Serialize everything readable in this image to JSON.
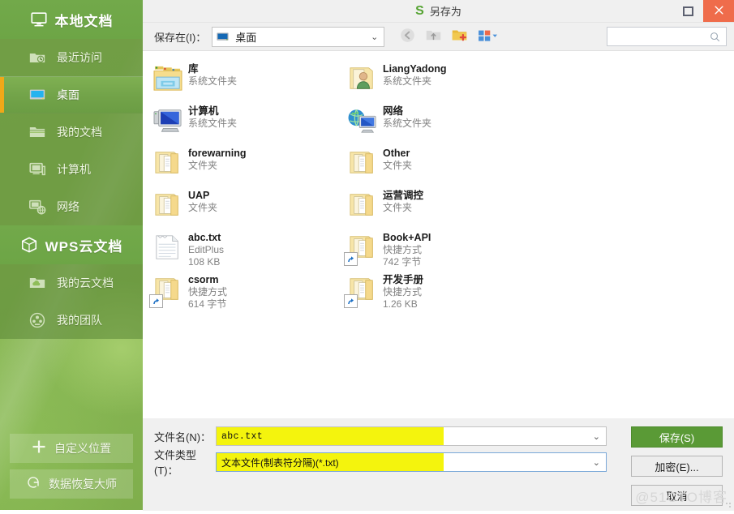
{
  "sidebar": {
    "local_header": {
      "label": "本地文档",
      "icon": "monitor-icon"
    },
    "local_items": [
      {
        "label": "最近访问",
        "icon": "recent-folder-icon",
        "selected": false
      },
      {
        "label": "桌面",
        "icon": "desktop-icon",
        "selected": true
      },
      {
        "label": "我的文档",
        "icon": "folder-icon",
        "selected": false
      },
      {
        "label": "计算机",
        "icon": "computer-icon",
        "selected": false
      },
      {
        "label": "网络",
        "icon": "network-icon",
        "selected": false
      }
    ],
    "cloud_header": {
      "label": "WPS云文档",
      "icon": "cube-icon"
    },
    "cloud_items": [
      {
        "label": "我的云文档",
        "icon": "cloud-folder-icon",
        "selected": false
      },
      {
        "label": "我的团队",
        "icon": "team-icon",
        "selected": false
      }
    ],
    "bottom_buttons": [
      {
        "label": "自定义位置",
        "icon": "plus-icon"
      },
      {
        "label": "数据恢复大师",
        "icon": "recovery-g-icon"
      }
    ]
  },
  "titlebar": {
    "logo_text": "S",
    "title": "另存为",
    "maximize_label": "maximize",
    "close_label": "close"
  },
  "toolbar": {
    "save_in_label": "保存在(I)：",
    "path_value": "桌面",
    "chevron": "⌄",
    "icons": [
      {
        "name": "back-icon",
        "enabled": false
      },
      {
        "name": "up-folder-icon",
        "enabled": false
      },
      {
        "name": "new-folder-icon",
        "enabled": true
      },
      {
        "name": "view-mode-icon",
        "enabled": true
      }
    ],
    "search_placeholder": "",
    "search_value": ""
  },
  "files": {
    "column1": [
      {
        "name": "库",
        "meta1": "系统文件夹",
        "meta2": "",
        "icon": "library-icon",
        "shortcut": false
      },
      {
        "name": "计算机",
        "meta1": "系统文件夹",
        "meta2": "",
        "icon": "computer-icon",
        "shortcut": false
      },
      {
        "name": "forewarning",
        "meta1": "文件夹",
        "meta2": "",
        "icon": "folder-icon",
        "shortcut": false
      },
      {
        "name": "UAP",
        "meta1": "文件夹",
        "meta2": "",
        "icon": "folder-icon",
        "shortcut": false
      },
      {
        "name": "abc.txt",
        "meta1": "EditPlus",
        "meta2": "108 KB",
        "icon": "text-file-icon",
        "shortcut": false
      },
      {
        "name": "csorm",
        "meta1": "快捷方式",
        "meta2": "614 字节",
        "icon": "folder-icon",
        "shortcut": true
      }
    ],
    "column2": [
      {
        "name": "LiangYadong",
        "meta1": "系统文件夹",
        "meta2": "",
        "icon": "user-folder-icon",
        "shortcut": false
      },
      {
        "name": "网络",
        "meta1": "系统文件夹",
        "meta2": "",
        "icon": "network-icon",
        "shortcut": false
      },
      {
        "name": "Other",
        "meta1": "文件夹",
        "meta2": "",
        "icon": "folder-icon",
        "shortcut": false
      },
      {
        "name": "运营调控",
        "meta1": "文件夹",
        "meta2": "",
        "icon": "folder-icon",
        "shortcut": false
      },
      {
        "name": "Book+API",
        "meta1": "快捷方式",
        "meta2": "742 字节",
        "icon": "folder-icon",
        "shortcut": true
      },
      {
        "name": "开发手册",
        "meta1": "快捷方式",
        "meta2": "1.26 KB",
        "icon": "folder-icon",
        "shortcut": true
      }
    ]
  },
  "form": {
    "filename_label": "文件名(N)：",
    "filename_value": "abc.txt",
    "filetype_label": "文件类型(T)：",
    "filetype_value": "文本文件(制表符分隔)(*.txt)",
    "chevron": "⌄",
    "buttons": {
      "save": "保存(S)",
      "encrypt": "加密(E)...",
      "cancel": "取消"
    }
  },
  "watermark": "@51CTO博客",
  "colors": {
    "sidebar_green": "#8cba56",
    "sidebar_header_green": "#6da546",
    "accent_orange": "#f0a818",
    "close_red": "#ef6c4b",
    "save_green": "#5a9a36",
    "highlight_yellow": "#f4f40d",
    "logo_green": "#55a332"
  }
}
